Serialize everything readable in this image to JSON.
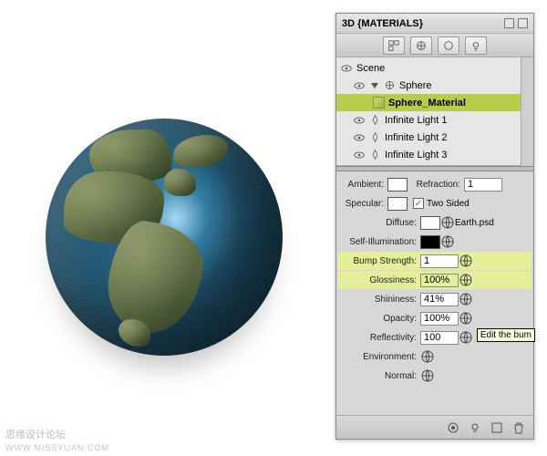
{
  "panel": {
    "title": "3D {MATERIALS}"
  },
  "scene": {
    "root": "Scene",
    "items": [
      {
        "label": "Sphere"
      },
      {
        "label": "Sphere_Material"
      },
      {
        "label": "Infinite Light 1"
      },
      {
        "label": "Infinite Light 2"
      },
      {
        "label": "Infinite Light 3"
      }
    ]
  },
  "props": {
    "ambient_label": "Ambient:",
    "refraction_label": "Refraction:",
    "refraction_value": "1",
    "specular_label": "Specular:",
    "twosided_label": "Two Sided",
    "diffuse_label": "Diffuse:",
    "diffuse_file": "Earth.psd",
    "selfillum_label": "Self-Illumination:",
    "bump_label": "Bump Strength:",
    "bump_value": "1",
    "gloss_label": "Glossiness:",
    "gloss_value": "100%",
    "shini_label": "Shininess:",
    "shini_value": "41%",
    "opacity_label": "Opacity:",
    "opacity_value": "100%",
    "reflect_label": "Reflectivity:",
    "reflect_value": "100",
    "env_label": "Environment:",
    "normal_label": "Normal:"
  },
  "tooltip": "Edit the bum",
  "watermark_cn": "思缘设计论坛",
  "watermark": "WWW.MISSYUAN.COM"
}
